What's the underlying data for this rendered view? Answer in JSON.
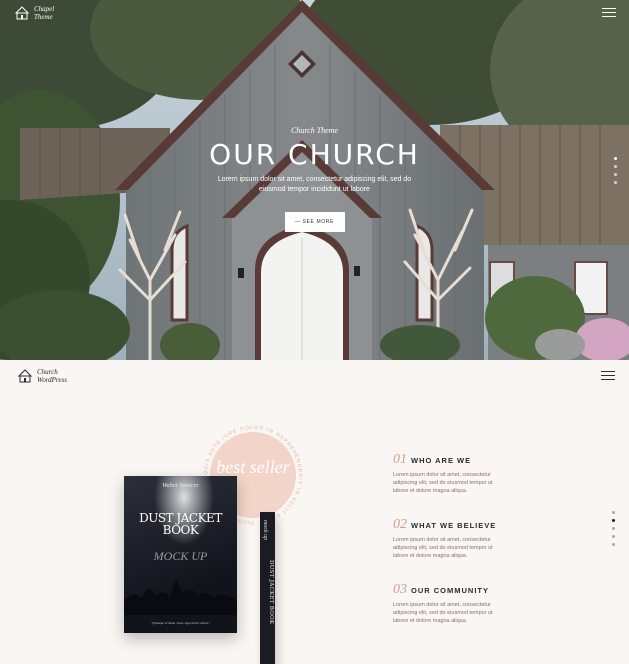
{
  "hero": {
    "logo": {
      "line1": "Chapel",
      "line2": "Theme"
    },
    "subtitle": "Church Theme",
    "title": "OUR CHURCH",
    "description": "Lorem ipsum dolor sit amet, consectetur adipiscing elit, sed do eiusmod tempor incididunt ut labore",
    "button_label": "— SEE MORE",
    "slides": 4,
    "active_slide": 0
  },
  "header": {
    "logo": {
      "line1": "Church",
      "line2": "WordPress"
    }
  },
  "product": {
    "badge_text": "best seller",
    "badge_ring_text": "QUIS AUTE IURE DOLOR IN REPREHENDERIT IN VELIT ESSE · DUIS AUTE IRURE ·",
    "book_author": "Walter Spencer",
    "book_title": "DUST JACKET BOOK",
    "book_subtitle": "MOCK UP",
    "book_blurb": "\"Quisque et diam risus, eget tortor dolor.\"",
    "spine_title": "DUST JACKET BOOK",
    "spine_mark": "mock up"
  },
  "features": [
    {
      "num": "01",
      "title": "WHO ARE WE",
      "text": "Lorem ipsum dolor sit amet, consectetur adipiscing elit, sed do eiusmod tempor ut labore et dolore magna aliqua."
    },
    {
      "num": "02",
      "title": "WHAT WE BELIEVE",
      "text": "Lorem ipsum dolor sit amet, consectetur adipiscing elit, sed do eiusmod tempor ut labore et dolore magna aliqua."
    },
    {
      "num": "03",
      "title": "OUR COMMUNITY",
      "text": "Lorem ipsum dolor sit amet, consectetur adipiscing elit, sed do eiusmod tempor ut labore et dolore magna aliqua."
    }
  ],
  "side_nav": {
    "count": 5,
    "active": 1
  },
  "colors": {
    "accent": "#c9a08f",
    "badge": "#f2d5c8",
    "background": "#faf6f3",
    "dark": "#2a2a33"
  }
}
